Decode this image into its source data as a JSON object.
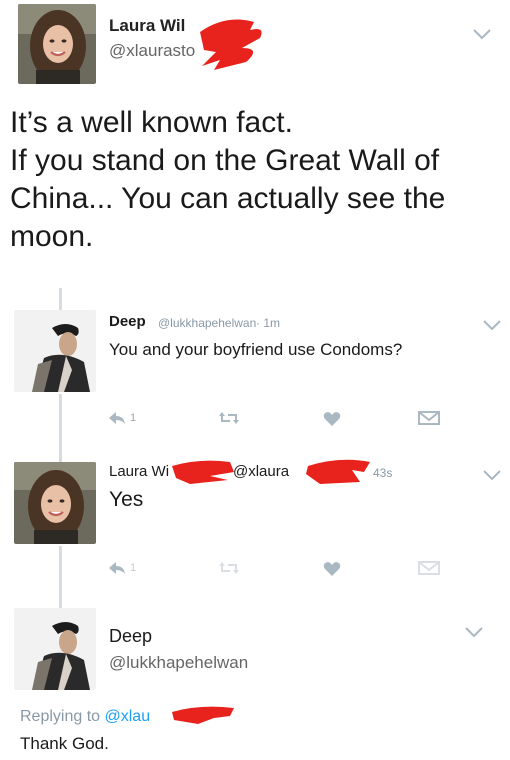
{
  "main_tweet": {
    "name": "Laura Wil",
    "handle": "@xlaurasto",
    "text_lines": [
      "It’s a well known fact.",
      "If you stand on the Great Wall of",
      "China... You can actually see the",
      "moon."
    ]
  },
  "reply1": {
    "name": "Deep",
    "handle": "@lukkhapehelwan",
    "time": "· 1m",
    "text": "You and your boyfriend use Condoms?",
    "reply_count": "1"
  },
  "reply2": {
    "name": "Laura Wi",
    "handle": "@xlaura",
    "time": "43s",
    "text": "Yes",
    "reply_count": "1"
  },
  "reply3": {
    "name": "Deep",
    "handle": "@lukkhapehelwan",
    "replying_prefix": "Replying to",
    "replying_handle": "@xlau",
    "text": "Thank God."
  },
  "icons": {
    "reply": "reply-arrow-icon",
    "retweet": "retweet-icon",
    "like": "heart-icon",
    "dm": "dm-envelope-icon",
    "menu": "chevron-down-icon"
  },
  "colors": {
    "redaction": "#e8231d",
    "link": "#1da1f2",
    "muted": "#657786",
    "action_grey": "#aab8c2",
    "thread_line": "#d6dbe0"
  }
}
